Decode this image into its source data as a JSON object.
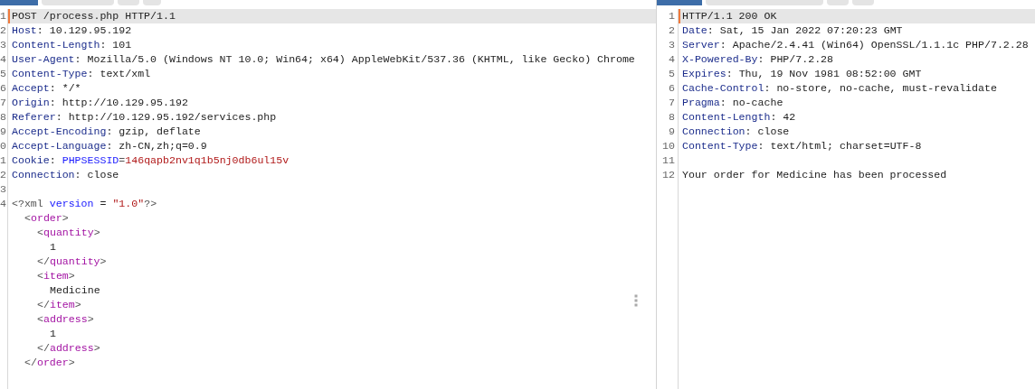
{
  "request": {
    "tabs": [
      {
        "selected": true
      },
      {
        "selected": false
      },
      {
        "selected": false
      },
      {
        "selected": false
      }
    ],
    "gutter": [
      "1",
      "2",
      "3",
      "4",
      "5",
      "6",
      "7",
      "8",
      "9",
      "0",
      "1",
      "2",
      "3",
      "4"
    ],
    "lines": [
      {
        "kind": "request_line",
        "text": "POST /process.php HTTP/1.1",
        "current": true
      },
      {
        "kind": "header",
        "name": "Host",
        "sep": ":",
        "value": "10.129.95.192"
      },
      {
        "kind": "header",
        "name": "Content-Length",
        "sep": ":",
        "value": "101"
      },
      {
        "kind": "header",
        "name": "User-Agent",
        "sep": ":",
        "value": "Mozilla/5.0 (Windows NT 10.0; Win64; x64) AppleWebKit/537.36 (KHTML, like Gecko) Chrome"
      },
      {
        "kind": "header",
        "name": "Content-Type",
        "sep": ":",
        "value": "text/xml"
      },
      {
        "kind": "header",
        "name": "Accept",
        "sep": ":",
        "value": "*/*"
      },
      {
        "kind": "header",
        "name": "Origin",
        "sep": ":",
        "value": "http://10.129.95.192"
      },
      {
        "kind": "header",
        "name": "Referer",
        "sep": ":",
        "value": "http://10.129.95.192/services.php"
      },
      {
        "kind": "header",
        "name": "Accept-Encoding",
        "sep": ":",
        "value": "gzip, deflate"
      },
      {
        "kind": "header",
        "name": "Accept-Language",
        "sep": ":",
        "value": "zh-CN,zh;q=0.9"
      },
      {
        "kind": "cookie",
        "name": "Cookie",
        "sep": ":",
        "cookie_name": "PHPSESSID",
        "eq": "=",
        "cookie_value": "146qapb2nv1q1b5nj0db6ul15v"
      },
      {
        "kind": "header",
        "name": "Connection",
        "sep": ":",
        "value": "close"
      },
      {
        "kind": "blank"
      },
      {
        "kind": "xml_decl",
        "open": "<?xml",
        "attr": "version",
        "eq": "=",
        "value": "\"1.0\"",
        "close": "?>"
      }
    ],
    "body": {
      "kind": "element",
      "open": [
        "<",
        "order",
        ">"
      ],
      "close": [
        "</",
        "order",
        ">"
      ],
      "children": [
        {
          "kind": "element",
          "open": [
            "<",
            "quantity",
            ">"
          ],
          "close": [
            "</",
            "quantity",
            ">"
          ],
          "children": [
            {
              "kind": "text",
              "text": "1"
            }
          ]
        },
        {
          "kind": "element",
          "open": [
            "<",
            "item",
            ">"
          ],
          "close": [
            "</",
            "item",
            ">"
          ],
          "children": [
            {
              "kind": "text",
              "text": "Medicine"
            }
          ]
        },
        {
          "kind": "element",
          "open": [
            "<",
            "address",
            ">"
          ],
          "close": [
            "</",
            "address",
            ">"
          ],
          "children": [
            {
              "kind": "text",
              "text": "1"
            }
          ]
        }
      ]
    }
  },
  "response": {
    "tabs": [
      {
        "selected": true
      },
      {
        "selected": false
      },
      {
        "selected": false
      },
      {
        "selected": false
      }
    ],
    "lines": [
      {
        "number": "1",
        "kind": "request_line",
        "text": "HTTP/1.1 200 OK",
        "current": true
      },
      {
        "number": "2",
        "kind": "header",
        "name": "Date",
        "sep": ":",
        "value": "Sat, 15 Jan 2022 07:20:23 GMT"
      },
      {
        "number": "3",
        "kind": "header",
        "name": "Server",
        "sep": ":",
        "value": "Apache/2.4.41 (Win64) OpenSSL/1.1.1c PHP/7.2.28"
      },
      {
        "number": "4",
        "kind": "header",
        "name": "X-Powered-By",
        "sep": ":",
        "value": "PHP/7.2.28"
      },
      {
        "number": "5",
        "kind": "header",
        "name": "Expires",
        "sep": ":",
        "value": "Thu, 19 Nov 1981 08:52:00 GMT"
      },
      {
        "number": "6",
        "kind": "header",
        "name": "Cache-Control",
        "sep": ":",
        "value": "no-store, no-cache, must-revalidate"
      },
      {
        "number": "7",
        "kind": "header",
        "name": "Pragma",
        "sep": ":",
        "value": "no-cache"
      },
      {
        "number": "8",
        "kind": "header",
        "name": "Content-Length",
        "sep": ":",
        "value": "42"
      },
      {
        "number": "9",
        "kind": "header",
        "name": "Connection",
        "sep": ":",
        "value": "close"
      },
      {
        "number": "10",
        "kind": "header",
        "name": "Content-Type",
        "sep": ":",
        "value": "text/html; charset=UTF-8"
      },
      {
        "number": "11",
        "kind": "blank"
      },
      {
        "number": "12",
        "kind": "text",
        "text": "Your order for Medicine has been processed"
      }
    ]
  }
}
